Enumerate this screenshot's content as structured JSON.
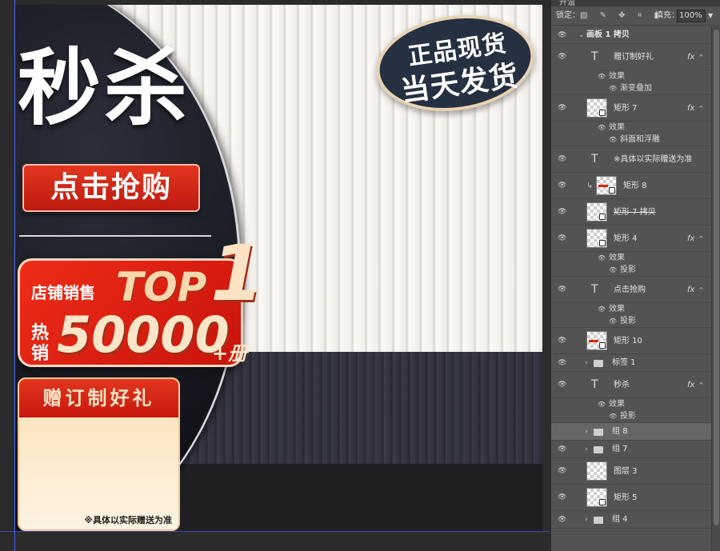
{
  "canvas": {
    "headline": "秒杀",
    "cta_label": "点击抢购",
    "store_sales_label": "店铺销售",
    "top_text": "TOP",
    "top_number": "1",
    "hot_char_1": "热",
    "hot_char_2": "销",
    "sales_number": "50000",
    "sales_suffix": "+册",
    "gift_title": "赠订制好礼",
    "gift_note": "※具体以实际赠送为准",
    "stamp_line_1": "正品现货",
    "stamp_line_2": "当天发货",
    "colors": {
      "accent_red": "#d82414",
      "dark_navy": "#253040",
      "cream": "#fbe1b5"
    }
  },
  "panel": {
    "tab_label": "升温",
    "lock_label": "锁定：",
    "fill_label": "填充：",
    "fill_value": "100%",
    "layers": {
      "artboard": "画板 1 拷贝",
      "l_gift_text": "赠订制好礼",
      "l_gift_effect": "效果",
      "l_gift_effect_item": "渐变叠加",
      "l_rect7": "矩形 7",
      "l_rect7_effect": "效果",
      "l_rect7_effect_item": "斜面和浮雕",
      "l_note_text": "※具体以实际赠送为准",
      "l_rect8": "矩形 8",
      "l_rect7copy": "矩形 7 拷贝",
      "l_rect4": "矩形 4",
      "l_rect4_effect": "效果",
      "l_rect4_effect_item": "投影",
      "l_cta_text": "点击抢购",
      "l_cta_effect": "效果",
      "l_cta_effect_item": "投影",
      "l_rect10": "矩形 10",
      "l_tag1": "标签 1",
      "l_miaosha": "秒杀",
      "l_miaosha_effect": "效果",
      "l_miaosha_effect_item": "投影",
      "l_group8": "组 8",
      "l_group7": "组 7",
      "l_layer3": "图层 3",
      "l_rect5": "矩形 5",
      "l_group4": "组 4"
    },
    "icons": [
      "eye-icon",
      "text-layer-icon",
      "folder-icon",
      "fx-icon",
      "lock-icon"
    ]
  }
}
